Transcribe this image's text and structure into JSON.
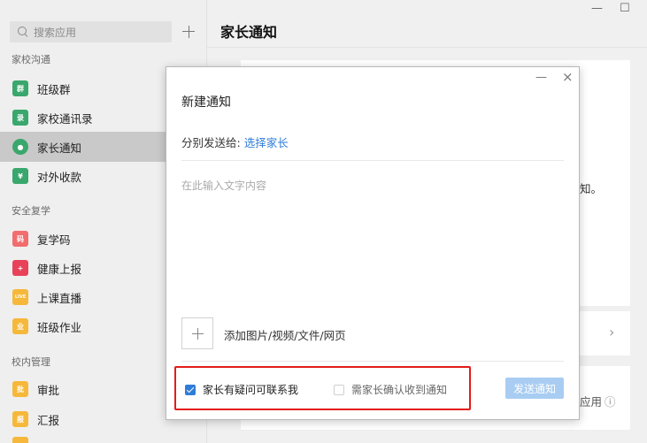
{
  "sidebar": {
    "search_placeholder": "搜索应用",
    "sections": [
      {
        "label": "家校沟通"
      },
      {
        "label": "安全复学"
      },
      {
        "label": "校内管理"
      }
    ],
    "items": [
      {
        "label": "班级群",
        "icon": "class-group-icon",
        "color": "#3aa76d",
        "glyph": "群"
      },
      {
        "label": "家校通讯录",
        "icon": "contacts-icon",
        "color": "#3aa76d",
        "glyph": "录"
      },
      {
        "label": "家长通知",
        "icon": "chat-bubble-icon",
        "color": "#3aa76d",
        "glyph": "●",
        "active": true
      },
      {
        "label": "对外收款",
        "icon": "payment-icon",
        "color": "#3aa76d",
        "glyph": "¥"
      },
      {
        "label": "复学码",
        "icon": "qr-code-icon",
        "color": "#f26d6d",
        "glyph": "码"
      },
      {
        "label": "健康上报",
        "icon": "health-report-icon",
        "color": "#e8425a",
        "glyph": "+"
      },
      {
        "label": "上课直播",
        "icon": "live-icon",
        "color": "#f6b83b",
        "glyph": "LIVE"
      },
      {
        "label": "班级作业",
        "icon": "homework-icon",
        "color": "#f6b83b",
        "glyph": "业"
      },
      {
        "label": "审批",
        "icon": "approval-icon",
        "color": "#f6b83b",
        "glyph": "批"
      },
      {
        "label": "汇报",
        "icon": "report-icon",
        "color": "#f6b83b",
        "glyph": "报"
      }
    ]
  },
  "main": {
    "title": "家长通知",
    "right_fragment_1": "知。",
    "right_fragment_2": "应用",
    "info_glyph": "ⓘ",
    "chevron_glyph": "›"
  },
  "window_controls": {
    "minimize": "—",
    "maximize": "☐"
  },
  "dialog": {
    "minimize": "—",
    "close": "×",
    "title": "新建通知",
    "recipient_label": "分别发送给:",
    "recipient_link": "选择家长",
    "content_placeholder": "在此输入文字内容",
    "attach_label": "添加图片/视频/文件/网页",
    "option_contact": "家长有疑问可联系我",
    "option_contact_checked": true,
    "option_confirm": "需家长确认收到通知",
    "option_confirm_checked": false,
    "send_label": "发送通知"
  }
}
